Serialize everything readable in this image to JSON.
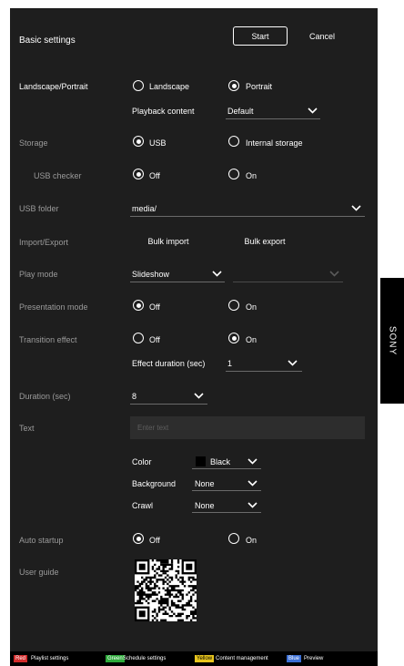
{
  "header": {
    "title": "Basic settings",
    "start_label": "Start",
    "cancel_label": "Cancel"
  },
  "side_logo": "SONY",
  "rows": {
    "orientation": {
      "label": "Landscape/Portrait",
      "opt1": "Landscape",
      "opt2": "Portrait",
      "selected": "Portrait"
    },
    "playback_content": {
      "label": "Playback content",
      "value": "Default"
    },
    "storage": {
      "label": "Storage",
      "opt1": "USB",
      "opt2": "Internal storage",
      "selected": "USB"
    },
    "usb_checker": {
      "label": "USB checker",
      "opt1": "Off",
      "opt2": "On",
      "selected": "Off"
    },
    "usb_folder": {
      "label": "USB folder",
      "value": "media/"
    },
    "import_export": {
      "label": "Import/Export",
      "bulk_import": "Bulk import",
      "bulk_export": "Bulk export"
    },
    "play_mode": {
      "label": "Play mode",
      "value": "Slideshow",
      "value2": ""
    },
    "presentation_mode": {
      "label": "Presentation mode",
      "opt1": "Off",
      "opt2": "On",
      "selected": "Off"
    },
    "transition_effect": {
      "label": "Transition effect",
      "opt1": "Off",
      "opt2": "On",
      "selected": "On"
    },
    "effect_duration": {
      "label": "Effect duration (sec)",
      "value": "1"
    },
    "duration": {
      "label": "Duration (sec)",
      "value": "8"
    },
    "text": {
      "label": "Text",
      "placeholder": "Enter text"
    },
    "color": {
      "label": "Color",
      "value": "Black"
    },
    "background": {
      "label": "Background",
      "value": "None"
    },
    "crawl": {
      "label": "Crawl",
      "value": "None"
    },
    "auto_startup": {
      "label": "Auto startup",
      "opt1": "Off",
      "opt2": "On",
      "selected": "Off"
    },
    "user_guide": {
      "label": "User guide"
    }
  },
  "footer": [
    {
      "badge": "Red",
      "text": "Playlist settings",
      "color": "#d22b2b"
    },
    {
      "badge": "Green",
      "text": "Schedule settings",
      "color": "#2eaa3b"
    },
    {
      "badge": "Yellow",
      "text": "Content management",
      "color": "#e8c51d"
    },
    {
      "badge": "Blue",
      "text": "Preview",
      "color": "#3b6fd6"
    }
  ]
}
